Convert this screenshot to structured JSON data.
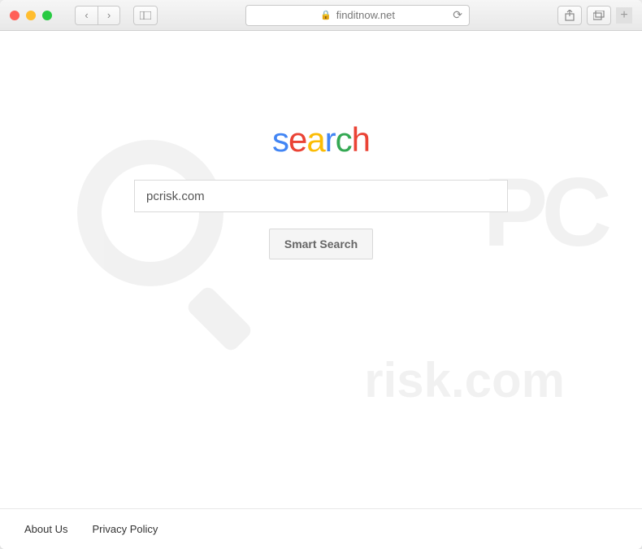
{
  "browser": {
    "url": "finditnow.net"
  },
  "page": {
    "logo": {
      "char1": "s",
      "char2": "e",
      "char3": "a",
      "char4": "r",
      "char5": "c",
      "char6": "h"
    },
    "search": {
      "value": "pcrisk.com",
      "button_label": "Smart Search"
    },
    "footer": {
      "about": "About Us",
      "privacy": "Privacy Policy"
    }
  }
}
